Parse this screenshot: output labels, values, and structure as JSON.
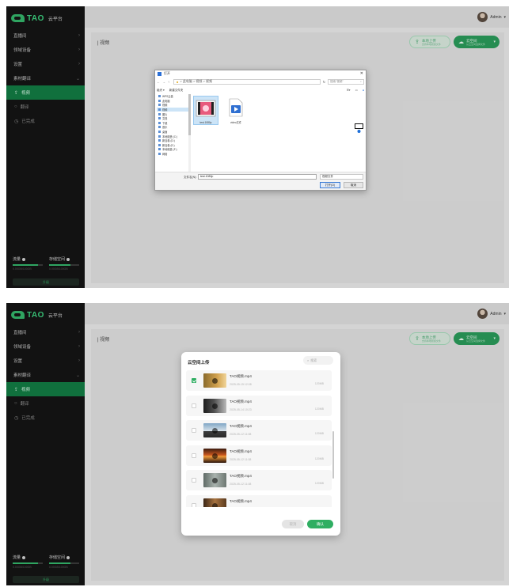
{
  "sidebar": {
    "logo_text": "TAO",
    "logo_sub": "云平台",
    "menu": [
      {
        "label": "直播间"
      },
      {
        "label": "领域设备"
      },
      {
        "label": "设置"
      },
      {
        "label": "素材翻译"
      }
    ],
    "submenu": [
      {
        "label": "视频",
        "icon": "upload-icon"
      },
      {
        "label": "翻译",
        "icon": "search-icon"
      },
      {
        "label": "已完成",
        "icon": "clock-icon"
      }
    ],
    "storage": {
      "left_label": "流量",
      "right_label": "存储空间",
      "left_value": "0.00GB/100GB",
      "right_value": "0.00GB/100GB",
      "left_fill": 0.85,
      "right_fill": 0.7
    },
    "bottom_button": "升级"
  },
  "header": {
    "user_name": "Admin"
  },
  "page": {
    "title": "| 视频",
    "btn_local_t1": "本地上传",
    "btn_local_t2": "支持本地视频文件",
    "btn_cloud_t1": "云空间",
    "btn_cloud_t2": "从云空间选择文件"
  },
  "file_dialog": {
    "title": "打开",
    "path": "> 此电脑 > 视频 > 视频",
    "search_placeholder": "搜索\"视频\"",
    "organize": "组织 ▾",
    "new_folder": "新建文件夹",
    "nav_items": [
      "WPS云盘",
      "此电脑",
      "视频",
      "视频",
      "图片",
      "文档",
      "下载",
      "音乐",
      "桌面",
      "本地磁盘 (C:)",
      "新加卷 (D:)",
      "新加卷 (E:)",
      "本地磁盘 (F:)",
      "网络"
    ],
    "files": [
      {
        "name": "test.1080p"
      },
      {
        "name": "video文件"
      }
    ],
    "filename_label": "文件名(N):",
    "filename_value": "test.1080p",
    "filetype": "视频文件",
    "open_label": "打开(O)",
    "cancel_label": "取消"
  },
  "cloud_modal": {
    "title": "云空间上传",
    "search_placeholder": "搜索",
    "items": [
      {
        "name": "TAO视频.mp4",
        "date": "2025-05-15 12:08",
        "size": "120MB",
        "checked": true
      },
      {
        "name": "TAO视频.mp4",
        "date": "2025-05-14 10:23",
        "size": "120MB",
        "checked": false
      },
      {
        "name": "TAO视频.mp4",
        "date": "2025-05-12 11:08",
        "size": "120MB",
        "checked": false
      },
      {
        "name": "TAO视频.mp4",
        "date": "2025-05-12 11:08",
        "size": "120MB",
        "checked": false
      },
      {
        "name": "TAO视频.mp4",
        "date": "2025-05-12 11:08",
        "size": "120MB",
        "checked": false
      },
      {
        "name": "TAO视频.mp4",
        "date": "",
        "size": "",
        "checked": false
      }
    ],
    "cancel_label": "取消",
    "confirm_label": "确认"
  }
}
